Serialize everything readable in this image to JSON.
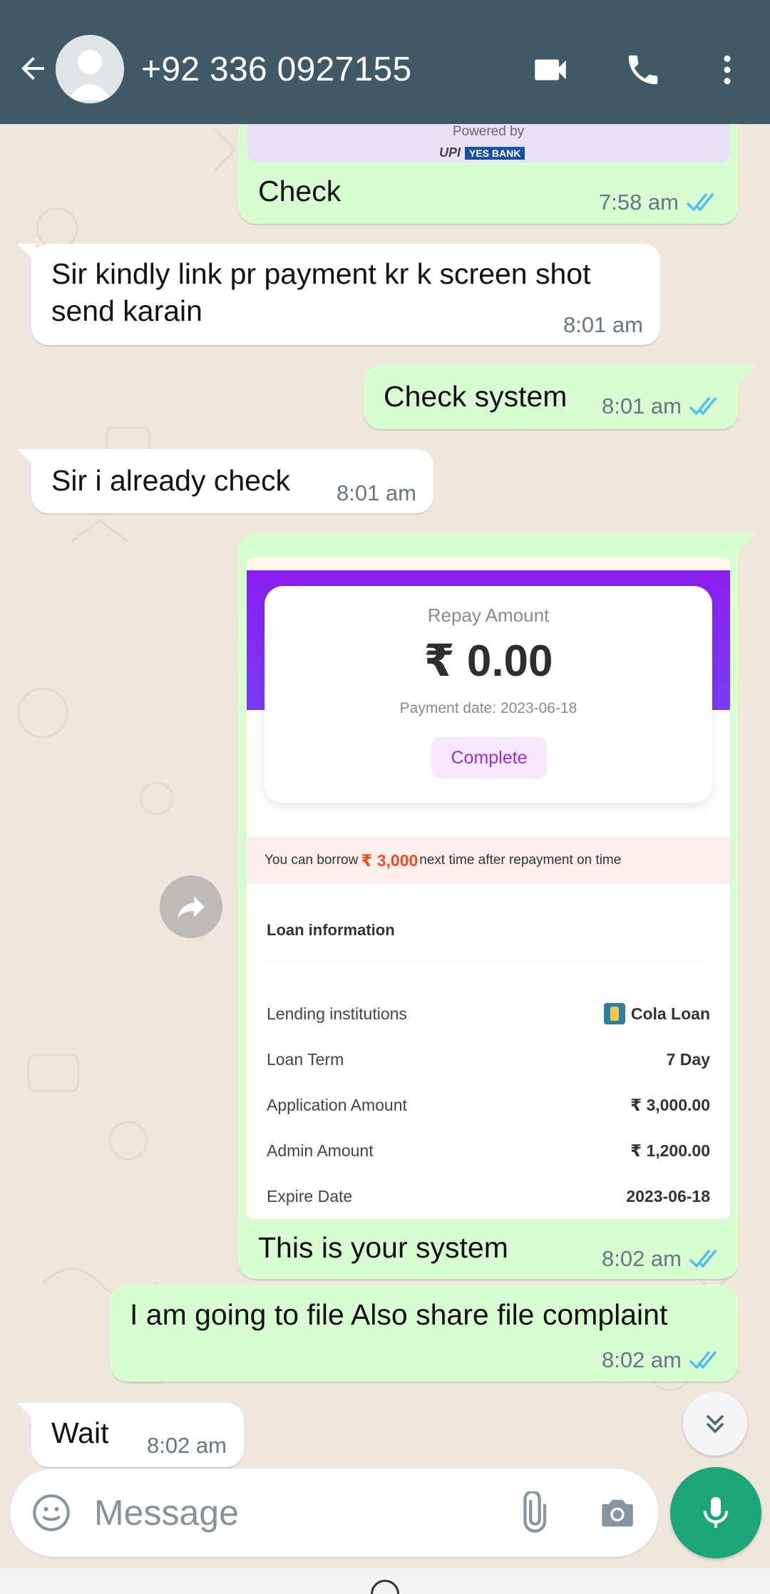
{
  "header": {
    "contact": "+92 336 0927155",
    "bg_color": "#3f5a66"
  },
  "messages": [
    {
      "dir": "out",
      "text": "Check",
      "time": "7:58 am",
      "read": true,
      "attachment": {
        "powered_by": "Powered by",
        "brand": "UPI",
        "bank": "YES BANK"
      }
    },
    {
      "dir": "in",
      "text": "Sir kindly link pr payment kr k screen shot send karain",
      "time": "8:01 am"
    },
    {
      "dir": "out",
      "text": "Check system",
      "time": "8:01 am",
      "read": true
    },
    {
      "dir": "in",
      "text": "Sir i already check",
      "time": "8:01 am"
    },
    {
      "dir": "out",
      "text": "This is your system",
      "time": "8:02 am",
      "read": true
    },
    {
      "dir": "out",
      "text": "I am going to file Also share file complaint",
      "time": "8:02 am",
      "read": true
    },
    {
      "dir": "in",
      "text": "Wait",
      "time": "8:02 am"
    }
  ],
  "screenshot": {
    "repay_label": "Repay Amount",
    "repay_amount": "₹ 0.00",
    "payment_date": "Payment date: 2023-06-18",
    "status": "Complete",
    "borrow_prefix": "You can borrow",
    "borrow_amount": "₹ 3,000",
    "borrow_suffix": "next time after repayment on time",
    "loan_title": "Loan information",
    "rows": [
      {
        "label": "Lending institutions",
        "value": "Cola Loan"
      },
      {
        "label": "Loan Term",
        "value": "7 Day"
      },
      {
        "label": "Application Amount",
        "value": "₹ 3,000.00"
      },
      {
        "label": "Admin Amount",
        "value": "₹ 1,200.00"
      },
      {
        "label": "Expire Date",
        "value": "2023-06-18"
      }
    ]
  },
  "composer": {
    "placeholder": "Message"
  },
  "colors": {
    "outgoing_bubble": "#d9fdd3",
    "incoming_bubble": "#ffffff",
    "read_ticks": "#53bdeb",
    "accent_green": "#1da57a",
    "card_purple": "#8a1ff0"
  },
  "icons": {
    "back": "arrow-left-icon",
    "video": "video-camera-icon",
    "call": "phone-icon",
    "more": "more-vertical-icon",
    "forward": "forward-icon",
    "scroll": "chevrons-down-icon",
    "emoji": "emoji-icon",
    "attach": "paperclip-icon",
    "camera": "camera-icon",
    "mic": "microphone-icon"
  }
}
